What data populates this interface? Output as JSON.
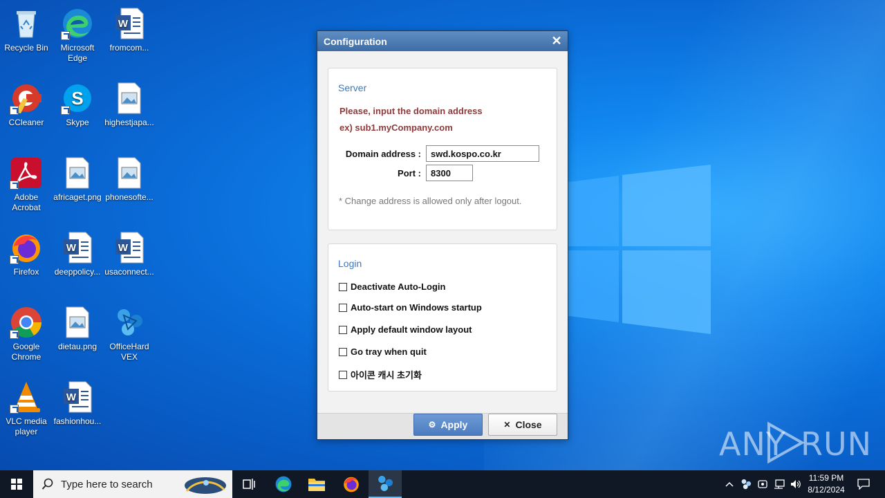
{
  "desktop": {
    "icons": [
      {
        "label": "Recycle Bin",
        "icon": "recycle-bin-icon"
      },
      {
        "label": "Microsoft Edge",
        "icon": "edge-icon"
      },
      {
        "label": "fromcom...",
        "icon": "word-doc-icon"
      },
      {
        "label": "CCleaner",
        "icon": "ccleaner-icon"
      },
      {
        "label": "Skype",
        "icon": "skype-icon"
      },
      {
        "label": "highestjapa...",
        "icon": "image-file-icon"
      },
      {
        "label": "Adobe Acrobat",
        "icon": "acrobat-icon"
      },
      {
        "label": "africaget.png",
        "icon": "image-file-icon"
      },
      {
        "label": "phonesofte...",
        "icon": "image-file-icon"
      },
      {
        "label": "Firefox",
        "icon": "firefox-icon"
      },
      {
        "label": "deeppolicy...",
        "icon": "word-doc-icon"
      },
      {
        "label": "usaconnect...",
        "icon": "word-doc-icon"
      },
      {
        "label": "Google Chrome",
        "icon": "chrome-icon"
      },
      {
        "label": "dietau.png",
        "icon": "image-file-icon"
      },
      {
        "label": "OfficeHard VEX",
        "icon": "officehard-icon"
      },
      {
        "label": "VLC media player",
        "icon": "vlc-icon"
      },
      {
        "label": "fashionhou...",
        "icon": "word-doc-icon"
      }
    ],
    "watermark": {
      "left": "ANY",
      "right": "RUN"
    }
  },
  "dialog": {
    "title": "Configuration",
    "server": {
      "title": "Server",
      "hint_line1": "Please, input the domain address",
      "hint_line2": "ex) sub1.myCompany.com",
      "domain_label": "Domain address :",
      "domain_value": "swd.kospo.co.kr",
      "port_label": "Port :",
      "port_value": "8300",
      "note": "* Change address is allowed only after logout."
    },
    "login": {
      "title": "Login",
      "options": [
        {
          "label": "Deactivate Auto-Login",
          "checked": false
        },
        {
          "label": "Auto-start on Windows startup",
          "checked": false
        },
        {
          "label": "Apply default window layout",
          "checked": false
        },
        {
          "label": "Go tray when quit",
          "checked": false
        },
        {
          "label": "아이콘 캐시 초기화",
          "checked": false
        }
      ]
    },
    "buttons": {
      "apply": "Apply",
      "close": "Close"
    }
  },
  "taskbar": {
    "search_placeholder": "Type here to search",
    "time": "11:59 PM",
    "date": "8/12/2024"
  }
}
